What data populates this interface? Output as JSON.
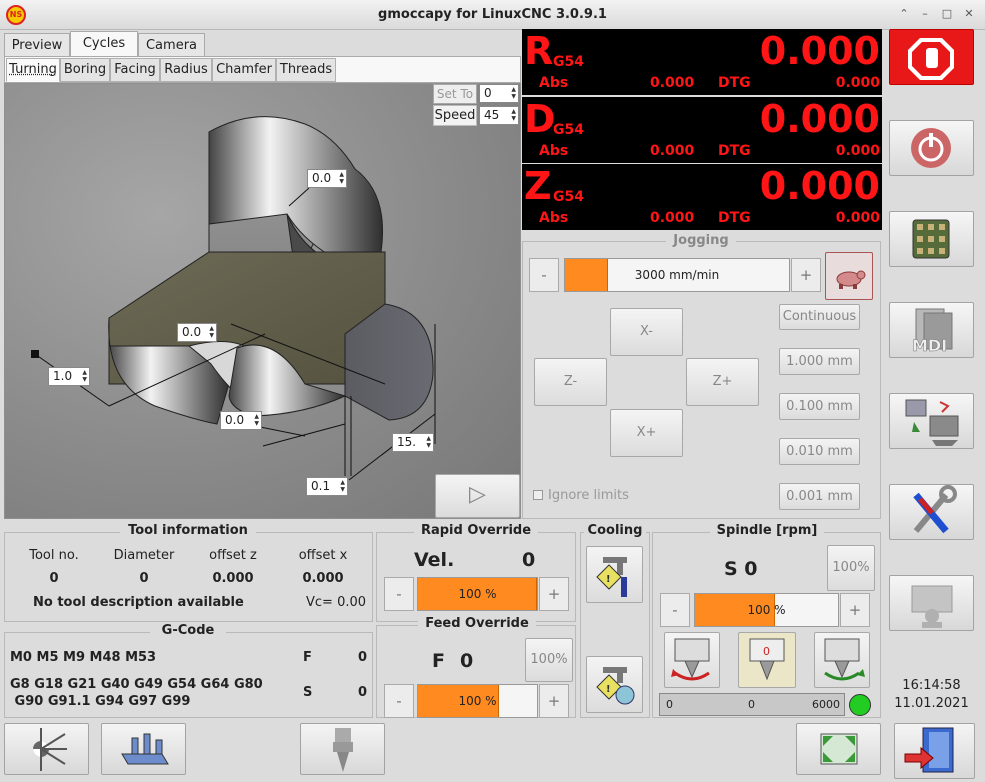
{
  "window": {
    "title": "gmoccapy for LinuxCNC  3.0.9.1",
    "logo_text": "NS"
  },
  "main_tabs": [
    {
      "label": "Preview"
    },
    {
      "label": "Cycles"
    },
    {
      "label": "Camera"
    }
  ],
  "cycle_tabs": [
    {
      "label": "Turning"
    },
    {
      "label": "Boring"
    },
    {
      "label": "Facing"
    },
    {
      "label": "Radius"
    },
    {
      "label": "Chamfer"
    },
    {
      "label": "Threads"
    }
  ],
  "cycle_view": {
    "set_tool_label": "Set To",
    "set_tool_value": "0",
    "speed_label": "Speed",
    "speed_value": "45",
    "params": [
      "0.0",
      "0.0",
      "1.0",
      "0.0",
      "15.",
      "0.1"
    ]
  },
  "dro": [
    {
      "axis": "R",
      "coord": "G54",
      "value": "0.000",
      "abs_label": "Abs",
      "abs_value": "0.000",
      "dtg_label": "DTG",
      "dtg_value": "0.000"
    },
    {
      "axis": "D",
      "coord": "G54",
      "value": "0.000",
      "abs_label": "Abs",
      "abs_value": "0.000",
      "dtg_label": "DTG",
      "dtg_value": "0.000"
    },
    {
      "axis": "Z",
      "coord": "G54",
      "value": "0.000",
      "abs_label": "Abs",
      "abs_value": "0.000",
      "dtg_label": "DTG",
      "dtg_value": "0.000"
    }
  ],
  "jogging": {
    "title": "Jogging",
    "minus": "-",
    "plus": "+",
    "velocity_text": "3000 mm/min",
    "velocity_fill": 0.19,
    "x_minus": "X-",
    "x_plus": "X+",
    "z_minus": "Z-",
    "z_plus": "Z+",
    "increments": [
      "Continuous",
      "1.000 mm",
      "0.100 mm",
      "0.010 mm",
      "0.001 mm"
    ],
    "ignore_limits": "Ignore limits"
  },
  "tool_info": {
    "title": "Tool information",
    "headers": [
      "Tool no.",
      "Diameter",
      "offset z",
      "offset x"
    ],
    "values": [
      "0",
      "0",
      "0.000",
      "0.000"
    ],
    "description": "No tool description available",
    "vc": "Vc= 0.00"
  },
  "rapid_override": {
    "title": "Rapid Override",
    "vel_label": "Vel.",
    "vel_value": "0",
    "percent_text": "100 %",
    "fill": 1.0,
    "minus": "-",
    "plus": "+"
  },
  "feed_override": {
    "title": "Feed Override",
    "f_label": "F",
    "f_value": "0",
    "reset_label": "100%",
    "percent_text": "100 %",
    "fill": 0.68,
    "minus": "-",
    "plus": "+"
  },
  "cooling": {
    "title": "Cooling"
  },
  "spindle": {
    "title": "Spindle [rpm]",
    "s_label": "S 0",
    "reset_label": "100%",
    "percent_text": "100 %",
    "fill": 0.56,
    "minus": "-",
    "plus": "+",
    "bar_min": "0",
    "bar_value": "0",
    "bar_max": "6000",
    "status_color": "#22cc22"
  },
  "gcode": {
    "title": "G-Code",
    "line1": "M0 M5 M9 M48 M53",
    "f_label": "F",
    "f_value": "0",
    "line2": "G8 G18 G21 G40 G49 G54 G64 G80",
    "line3": " G90 G91.1 G94 G97 G99",
    "s_label": "S",
    "s_value": "0"
  },
  "clock": {
    "time": "16:14:58",
    "date": "11.01.2021"
  },
  "colors": {
    "accent": "#ff8a20",
    "dro_text": "#ff1515",
    "estop": "#e81818"
  }
}
